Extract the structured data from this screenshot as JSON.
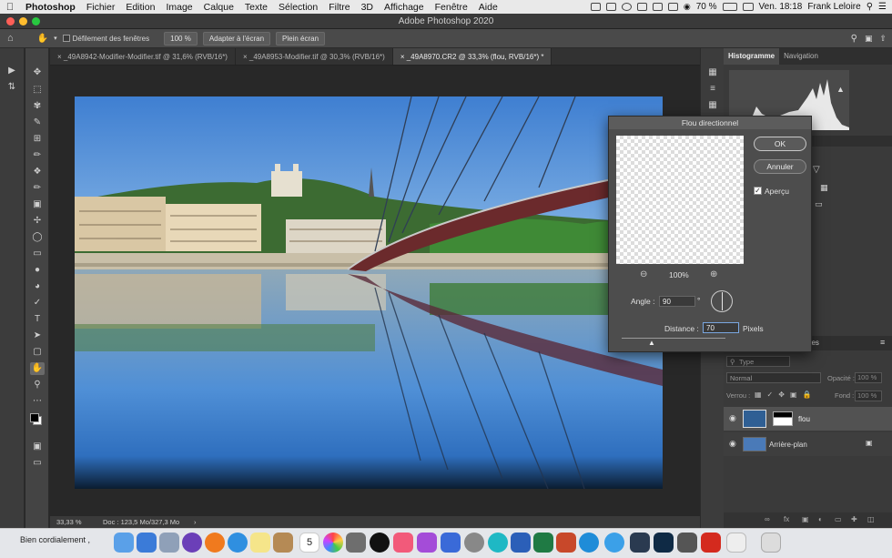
{
  "menubar": {
    "app": "Photoshop",
    "items": [
      "Fichier",
      "Edition",
      "Image",
      "Calque",
      "Texte",
      "Sélection",
      "Filtre",
      "3D",
      "Affichage",
      "Fenêtre",
      "Aide"
    ],
    "battery": "70 %",
    "clock": "Ven. 18:18",
    "user": "Frank Leloire"
  },
  "window": {
    "title": "Adobe Photoshop 2020"
  },
  "options": {
    "scroll_all": "Défilement des fenêtres",
    "zoom": "100 %",
    "fit": "Adapter à l'écran",
    "fill": "Plein écran"
  },
  "tabs": [
    {
      "label": "_49A8942-Modifier-Modifier.tif @ 31,6% (RVB/16*)"
    },
    {
      "label": "_49A8953-Modifier.tif @ 30,3% (RVB/16*)"
    },
    {
      "label": "_49A8970.CR2 @ 33,3% (flou, RVB/16*) *"
    }
  ],
  "status": {
    "zoom": "33,33 %",
    "doc": "Doc : 123,5 Mo/327,3 Mo"
  },
  "panels": {
    "histogram_tab": "Histogramme",
    "navigation_tab": "Navigation",
    "layers_tab_fragment": "hes",
    "type_filter": "Type",
    "blend_mode": "Normal",
    "opacity_label": "Opacité :",
    "opacity_value": "100 %",
    "lock_label": "Verrou :",
    "fill_label": "Fond :",
    "fill_value": "100 %",
    "layers": [
      {
        "name": "flou"
      },
      {
        "name": "Arrière-plan"
      }
    ]
  },
  "dialog": {
    "title": "Flou directionnel",
    "ok": "OK",
    "cancel": "Annuler",
    "preview_label": "Aperçu",
    "zoom": "100%",
    "angle_label": "Angle :",
    "angle_value": "90",
    "angle_unit": "°",
    "distance_label": "Distance :",
    "distance_value": "70",
    "distance_unit": "Pixels"
  },
  "dock": {
    "message": "Bien cordialement ,",
    "calendar_day": "5"
  },
  "colors": {
    "accent": "#3d7ad8",
    "dock_bg": "#e4e6ea",
    "panel_bg": "#3a3a3a"
  }
}
